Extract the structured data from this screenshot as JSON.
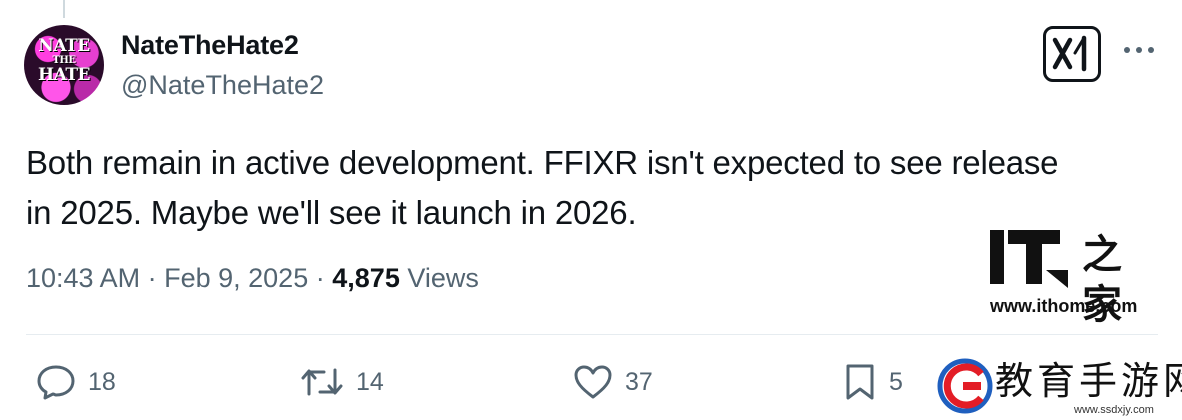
{
  "author": {
    "avatar_text_top": "NATE",
    "avatar_text_mid": "THE",
    "avatar_text_bottom": "HATE",
    "display_name": "NateTheHate2",
    "handle": "@NateTheHate2"
  },
  "tweet": {
    "text_line_1": "Both remain in active development. FFIXR isn't expected to see release",
    "text_line_2": "in 2025. Maybe we'll see it launch in 2026.",
    "time": "10:43 AM",
    "date": "Feb 9, 2025",
    "separator": "·",
    "views_count": "4,875",
    "views_label": "Views"
  },
  "actions": {
    "replies": "18",
    "reposts": "14",
    "likes": "37",
    "bookmarks": "5"
  },
  "watermarks": {
    "ithome_cn": "之家",
    "ithome_url": "www.ithome.com",
    "edu_text": "教育手游网",
    "edu_url": "www.ssdxjy.com"
  },
  "icons": [
    "grok-icon",
    "more-icon",
    "reply-icon",
    "repost-icon",
    "like-icon",
    "bookmark-icon"
  ],
  "colors": {
    "text": "#0f1419",
    "secondary": "#536471",
    "divider": "#e6ecf0",
    "edu_red": "#e31d26",
    "edu_blue": "#1f5fbf"
  }
}
